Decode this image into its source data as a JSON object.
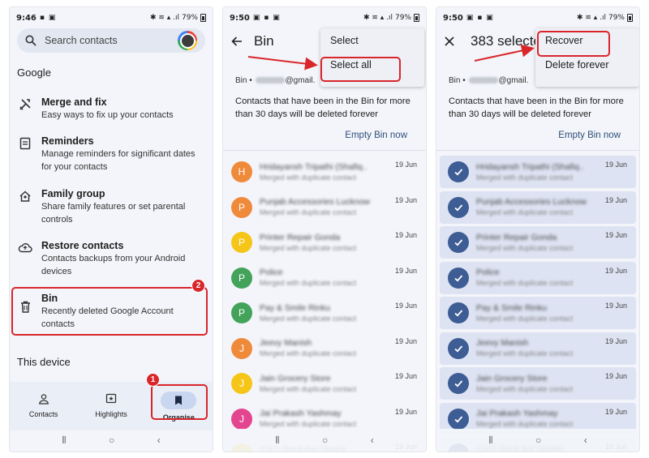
{
  "colors": {
    "highlight": "#d9262b",
    "accent_text": "#2e4e7a",
    "checked_avatar": "#3e5d94"
  },
  "screen1": {
    "status": {
      "time": "9:46",
      "battery": "79%"
    },
    "search": {
      "placeholder": "Search contacts",
      "icon": "search-icon"
    },
    "google_header": "Google",
    "items": [
      {
        "icon": "merge-tools-icon",
        "title": "Merge and fix",
        "subtitle": "Easy ways to fix up your contacts"
      },
      {
        "icon": "reminder-icon",
        "title": "Reminders",
        "subtitle": "Manage reminders for significant dates for your contacts"
      },
      {
        "icon": "family-home-icon",
        "title": "Family group",
        "subtitle": "Share family features or set parental controls"
      },
      {
        "icon": "cloud-restore-icon",
        "title": "Restore contacts",
        "subtitle": "Contacts backups from your Android devices"
      },
      {
        "icon": "trash-icon",
        "title": "Bin",
        "subtitle": "Recently deleted Google Account contacts"
      }
    ],
    "device_header": "This device",
    "nav": [
      {
        "icon": "person-icon",
        "label": "Contacts"
      },
      {
        "icon": "highlights-icon",
        "label": "Highlights"
      },
      {
        "icon": "bookmark-icon",
        "label": "Organise"
      }
    ],
    "step_badges": [
      "2",
      "1"
    ]
  },
  "screen2": {
    "status": {
      "time": "9:50",
      "battery": "79%"
    },
    "title": "Bin",
    "account_prefix": "Bin •",
    "account_suffix": "@gmail.",
    "description": "Contacts that have been in the Bin for more than 30 days will be deleted forever",
    "empty_bin": "Empty Bin now",
    "menu": [
      "Select",
      "Select all"
    ],
    "contacts": [
      {
        "initial": "H",
        "color": "#f08a3b",
        "name": "Hridayansh Tripathi (Shafiq..",
        "sub": "Merged with duplicate contact",
        "date": "19 Jun"
      },
      {
        "initial": "P",
        "color": "#f08a3b",
        "name": "Punjab Accessories Lucknow",
        "sub": "Merged with duplicate contact",
        "date": "19 Jun"
      },
      {
        "initial": "P",
        "color": "#f5c518",
        "name": "Printer Repair Gonda",
        "sub": "Merged with duplicate contact",
        "date": "19 Jun"
      },
      {
        "initial": "P",
        "color": "#43a35a",
        "name": "Police",
        "sub": "Merged with duplicate contact",
        "date": "19 Jun"
      },
      {
        "initial": "P",
        "color": "#43a35a",
        "name": "Pay & Smile Rinku",
        "sub": "Merged with duplicate contact",
        "date": "19 Jun"
      },
      {
        "initial": "J",
        "color": "#f08a3b",
        "name": "Jeevy Manish",
        "sub": "Merged with duplicate contact",
        "date": "19 Jun"
      },
      {
        "initial": "J",
        "color": "#f5c518",
        "name": "Jain Grocery Store",
        "sub": "Merged with duplicate contact",
        "date": "19 Jun"
      },
      {
        "initial": "J",
        "color": "#e3458f",
        "name": "Jai Prakash Yashmay",
        "sub": "Merged with duplicate contact",
        "date": "19 Jun"
      },
      {
        "initial": "I",
        "color": "#f5c518",
        "name": "ICICI Stock Aur Shukla",
        "sub": "Merged with duplicate contact",
        "date": "19 Jun"
      }
    ]
  },
  "screen3": {
    "status": {
      "time": "9:50",
      "battery": "79%"
    },
    "title": "383 selecte",
    "account_prefix": "Bin •",
    "account_suffix": "@gmail.",
    "description": "Contacts that have been in the Bin for more than 30 days will be deleted forever",
    "empty_bin": "Empty Bin now",
    "menu": [
      "Recover",
      "Delete forever"
    ],
    "contacts": [
      {
        "name": "Hridayansh Tripathi (Shafiq..",
        "sub": "Merged with duplicate contact",
        "date": "19 Jun"
      },
      {
        "name": "Punjab Accessories Lucknow",
        "sub": "Merged with duplicate contact",
        "date": "19 Jun"
      },
      {
        "name": "Printer Repair Gonda",
        "sub": "Merged with duplicate contact",
        "date": "19 Jun"
      },
      {
        "name": "Police",
        "sub": "Merged with duplicate contact",
        "date": "19 Jun"
      },
      {
        "name": "Pay & Smile Rinku",
        "sub": "Merged with duplicate contact",
        "date": "19 Jun"
      },
      {
        "name": "Jeevy Manish",
        "sub": "Merged with duplicate contact",
        "date": "19 Jun"
      },
      {
        "name": "Jain Grocery Store",
        "sub": "Merged with duplicate contact",
        "date": "19 Jun"
      },
      {
        "name": "Jai Prakash Yashmay",
        "sub": "Merged with duplicate contact",
        "date": "19 Jun"
      },
      {
        "name": "ICICI Stock Aur Shukla",
        "sub": "Merged with duplicate contact",
        "date": "19 Jun"
      }
    ]
  }
}
